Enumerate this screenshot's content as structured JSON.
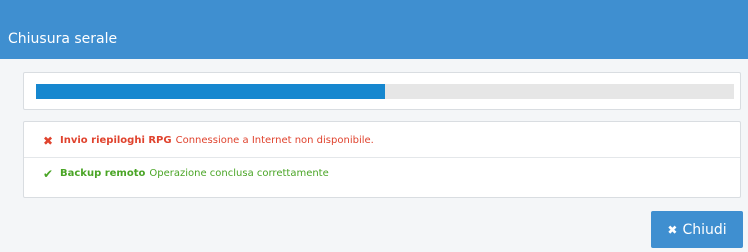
{
  "modal": {
    "title": "Chiusura serale",
    "progress": {
      "fraction": 0.5
    },
    "messages": [
      {
        "icon": "x-icon",
        "status_color": "#e0432e",
        "title": "Invio riepiloghi RPG",
        "text": "Connessione a Internet non disponibile."
      },
      {
        "icon": "check-icon",
        "status_color": "#4aa526",
        "title": "Backup remoto",
        "text": "Operazione conclusa correttamente"
      }
    ],
    "close_button": {
      "icon": "close-icon",
      "label": "Chiudi"
    }
  },
  "colors": {
    "header": "#3f8fd0",
    "progress_fill": "#1687cf",
    "progress_track": "#e6e6e6",
    "background": "#f4f6f8"
  }
}
